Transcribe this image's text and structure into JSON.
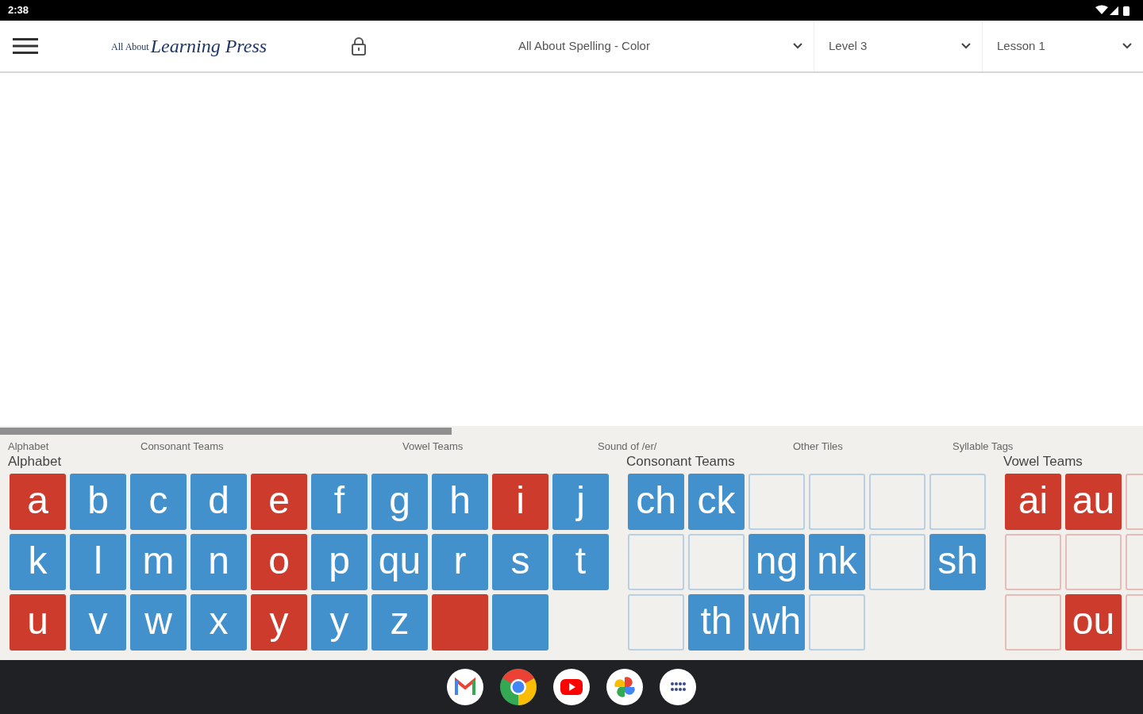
{
  "status_bar": {
    "time": "2:38"
  },
  "header": {
    "logo": {
      "small": "All About",
      "script": "Learning Press"
    },
    "dropdowns": [
      {
        "value": "All About Spelling - Color"
      },
      {
        "value": "Level 3"
      },
      {
        "value": "Lesson 1"
      }
    ]
  },
  "scrollbar": {
    "level": 0.395
  },
  "section_tabs": [
    {
      "label": "Alphabet"
    },
    {
      "label": "Consonant Teams"
    },
    {
      "label": "Vowel Teams"
    },
    {
      "label": "Sound of /er/"
    },
    {
      "label": "Other Tiles"
    },
    {
      "label": "Syllable Tags"
    }
  ],
  "sections": [
    {
      "title": "Alphabet",
      "rows": [
        [
          {
            "kind": "letter",
            "text": "a",
            "color": "#cc3b2c"
          },
          {
            "kind": "letter",
            "text": "b",
            "color": "#4291cd"
          },
          {
            "kind": "letter",
            "text": "c",
            "color": "#4291cd"
          },
          {
            "kind": "letter",
            "text": "d",
            "color": "#4291cd"
          },
          {
            "kind": "letter",
            "text": "e",
            "color": "#cc3b2c"
          },
          {
            "kind": "letter",
            "text": "f",
            "color": "#4291cd"
          },
          {
            "kind": "letter",
            "text": "g",
            "color": "#4291cd"
          },
          {
            "kind": "letter",
            "text": "h",
            "color": "#4291cd"
          },
          {
            "kind": "letter",
            "text": "i",
            "color": "#cc3b2c"
          },
          {
            "kind": "letter",
            "text": "j",
            "color": "#4291cd"
          }
        ],
        [
          {
            "kind": "letter",
            "text": "k",
            "color": "#4291cd"
          },
          {
            "kind": "letter",
            "text": "l",
            "color": "#4291cd"
          },
          {
            "kind": "letter",
            "text": "m",
            "color": "#4291cd"
          },
          {
            "kind": "letter",
            "text": "n",
            "color": "#4291cd"
          },
          {
            "kind": "letter",
            "text": "o",
            "color": "#cc3b2c"
          },
          {
            "kind": "letter",
            "text": "p",
            "color": "#4291cd"
          },
          {
            "kind": "letter",
            "text": "qu",
            "color": "#4291cd"
          },
          {
            "kind": "letter",
            "text": "r",
            "color": "#4291cd"
          },
          {
            "kind": "letter",
            "text": "s",
            "color": "#4291cd"
          },
          {
            "kind": "letter",
            "text": "t",
            "color": "#4291cd"
          }
        ],
        [
          {
            "kind": "letter",
            "text": "u",
            "color": "#cc3b2c"
          },
          {
            "kind": "letter",
            "text": "v",
            "color": "#4291cd"
          },
          {
            "kind": "letter",
            "text": "w",
            "color": "#4291cd"
          },
          {
            "kind": "letter",
            "text": "x",
            "color": "#4291cd"
          },
          {
            "kind": "letter",
            "text": "y",
            "color": "#cc3b2c"
          },
          {
            "kind": "letter",
            "text": "y",
            "color": "#4291cd"
          },
          {
            "kind": "letter",
            "text": "z",
            "color": "#4291cd"
          },
          {
            "kind": "blank",
            "color": "#cc3b2c"
          },
          {
            "kind": "blank",
            "color": "#4291cd"
          }
        ]
      ]
    },
    {
      "title": "Consonant Teams",
      "rows": [
        [
          {
            "kind": "letter",
            "text": "ch",
            "color": "#4291cd"
          },
          {
            "kind": "letter",
            "text": "ck",
            "color": "#4291cd"
          },
          {
            "kind": "empty",
            "color": "#b9cfe2"
          },
          {
            "kind": "empty",
            "color": "#b9cfe2"
          },
          {
            "kind": "empty",
            "color": "#b9cfe2"
          },
          {
            "kind": "empty",
            "color": "#b9cfe2"
          }
        ],
        [
          {
            "kind": "empty",
            "color": "#b9cfe2"
          },
          {
            "kind": "empty",
            "color": "#b9cfe2"
          },
          {
            "kind": "letter",
            "text": "ng",
            "color": "#4291cd"
          },
          {
            "kind": "letter",
            "text": "nk",
            "color": "#4291cd"
          },
          {
            "kind": "empty",
            "color": "#b9cfe2"
          },
          {
            "kind": "letter",
            "text": "sh",
            "color": "#4291cd"
          }
        ],
        [
          {
            "kind": "empty",
            "color": "#b9cfe2"
          },
          {
            "kind": "letter",
            "text": "th",
            "color": "#4291cd"
          },
          {
            "kind": "letter",
            "text": "wh",
            "color": "#4291cd"
          },
          {
            "kind": "empty",
            "color": "#b9cfe2"
          }
        ]
      ]
    },
    {
      "title": "Vowel Teams",
      "rows": [
        [
          {
            "kind": "letter",
            "text": "ai",
            "color": "#cc3b2c"
          },
          {
            "kind": "letter",
            "text": "au",
            "color": "#cc3b2c"
          },
          {
            "kind": "empty",
            "color": "#e6bcb6"
          }
        ],
        [
          {
            "kind": "empty",
            "color": "#e6bcb6"
          },
          {
            "kind": "empty",
            "color": "#e6bcb6"
          },
          {
            "kind": "empty",
            "color": "#e6bcb6"
          }
        ],
        [
          {
            "kind": "empty",
            "color": "#e6bcb6"
          },
          {
            "kind": "letter",
            "text": "ou",
            "color": "#cc3b2c"
          },
          {
            "kind": "empty",
            "color": "#e6bcb6"
          }
        ]
      ]
    }
  ]
}
